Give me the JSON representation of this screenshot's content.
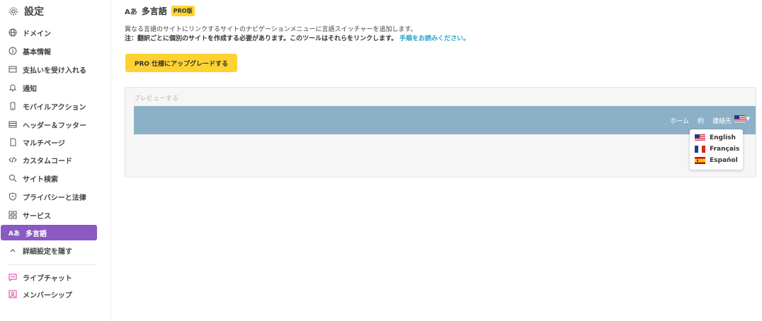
{
  "sidebar": {
    "title": "設定",
    "items": [
      {
        "label": "ドメイン",
        "icon": "globe-icon"
      },
      {
        "label": "基本情報",
        "icon": "info-icon"
      },
      {
        "label": "支払いを受け入れる",
        "icon": "payment-icon"
      },
      {
        "label": "通知",
        "icon": "bell-icon"
      },
      {
        "label": "モバイルアクション",
        "icon": "mobile-icon"
      },
      {
        "label": "ヘッダー＆フッター",
        "icon": "header-footer-icon"
      },
      {
        "label": "マルチページ",
        "icon": "pages-icon"
      },
      {
        "label": "カスタムコード",
        "icon": "code-icon"
      },
      {
        "label": "サイト検索",
        "icon": "search-icon"
      },
      {
        "label": "プライバシーと法律",
        "icon": "shield-icon"
      },
      {
        "label": "サービス",
        "icon": "grid-icon"
      },
      {
        "label": "多言語",
        "icon": "language-icon",
        "active": true
      },
      {
        "label": "詳細設定を隠す",
        "icon": "chevron-up-icon"
      },
      {
        "label": "ライブチャット",
        "icon": "chat-icon"
      },
      {
        "label": "メンバーシップ",
        "icon": "membership-icon"
      }
    ]
  },
  "main": {
    "title_icon_text": "Aあ",
    "title": "多言語",
    "badge": "PRO版",
    "description": "異なる言語のサイトにリンクするサイトのナビゲーションメニューに言語スイッチャーを追加します。",
    "note": "注：翻訳ごとに個別のサイトを作成する必要があります。このツールはそれらをリンクします。",
    "note_link": "手順をお読みください。",
    "upgrade_button": "PRO 仕様にアップグレードする"
  },
  "preview": {
    "label": "プレビューする",
    "nav_links": [
      "ホーム",
      "約",
      "連絡先"
    ],
    "languages": [
      {
        "label": "English",
        "flag": "us-flag"
      },
      {
        "label": "Français",
        "flag": "fr-flag"
      },
      {
        "label": "Español",
        "flag": "es-flag"
      }
    ]
  },
  "colors": {
    "accent": "#8a59c4",
    "upgrade": "#ffd233",
    "nav_bar": "#8cb1c7",
    "link": "#2aa3c9"
  }
}
